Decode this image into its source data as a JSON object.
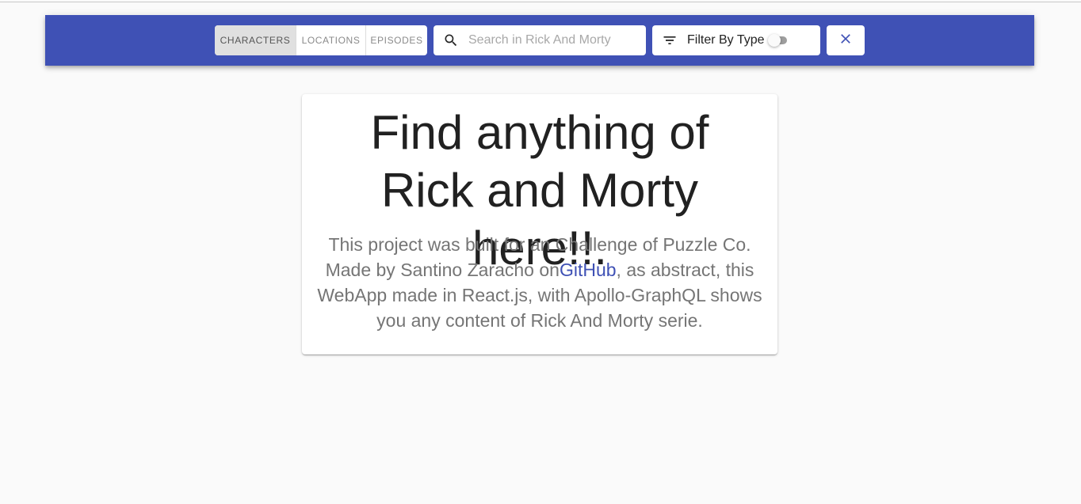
{
  "toolbar": {
    "tabs": [
      {
        "label": "CHARACTERS",
        "selected": true
      },
      {
        "label": "LOCATIONS",
        "selected": false
      },
      {
        "label": "EPISODES",
        "selected": false
      }
    ],
    "search": {
      "placeholder": "Search in Rick And Morty",
      "value": "",
      "icon": "search-icon"
    },
    "filter": {
      "label": "Filter By Type",
      "icon": "filter-list-icon",
      "toggle_on": false
    },
    "clear_icon": "close-icon"
  },
  "hero": {
    "title": "Find anything of Rick and Morty here!!.",
    "text_before_link": "This project was built for an Challenge of Puzzle Co. Made by Santino Zaracho on",
    "link_label": "GitHub",
    "text_after_link": ", as abstract, this WebApp made in React.js, with Apollo-GraphQL shows you any content of Rick And Morty serie."
  },
  "colors": {
    "appbar": "#3f51b5",
    "accent": "#3f51b5",
    "background": "#fafafa"
  }
}
